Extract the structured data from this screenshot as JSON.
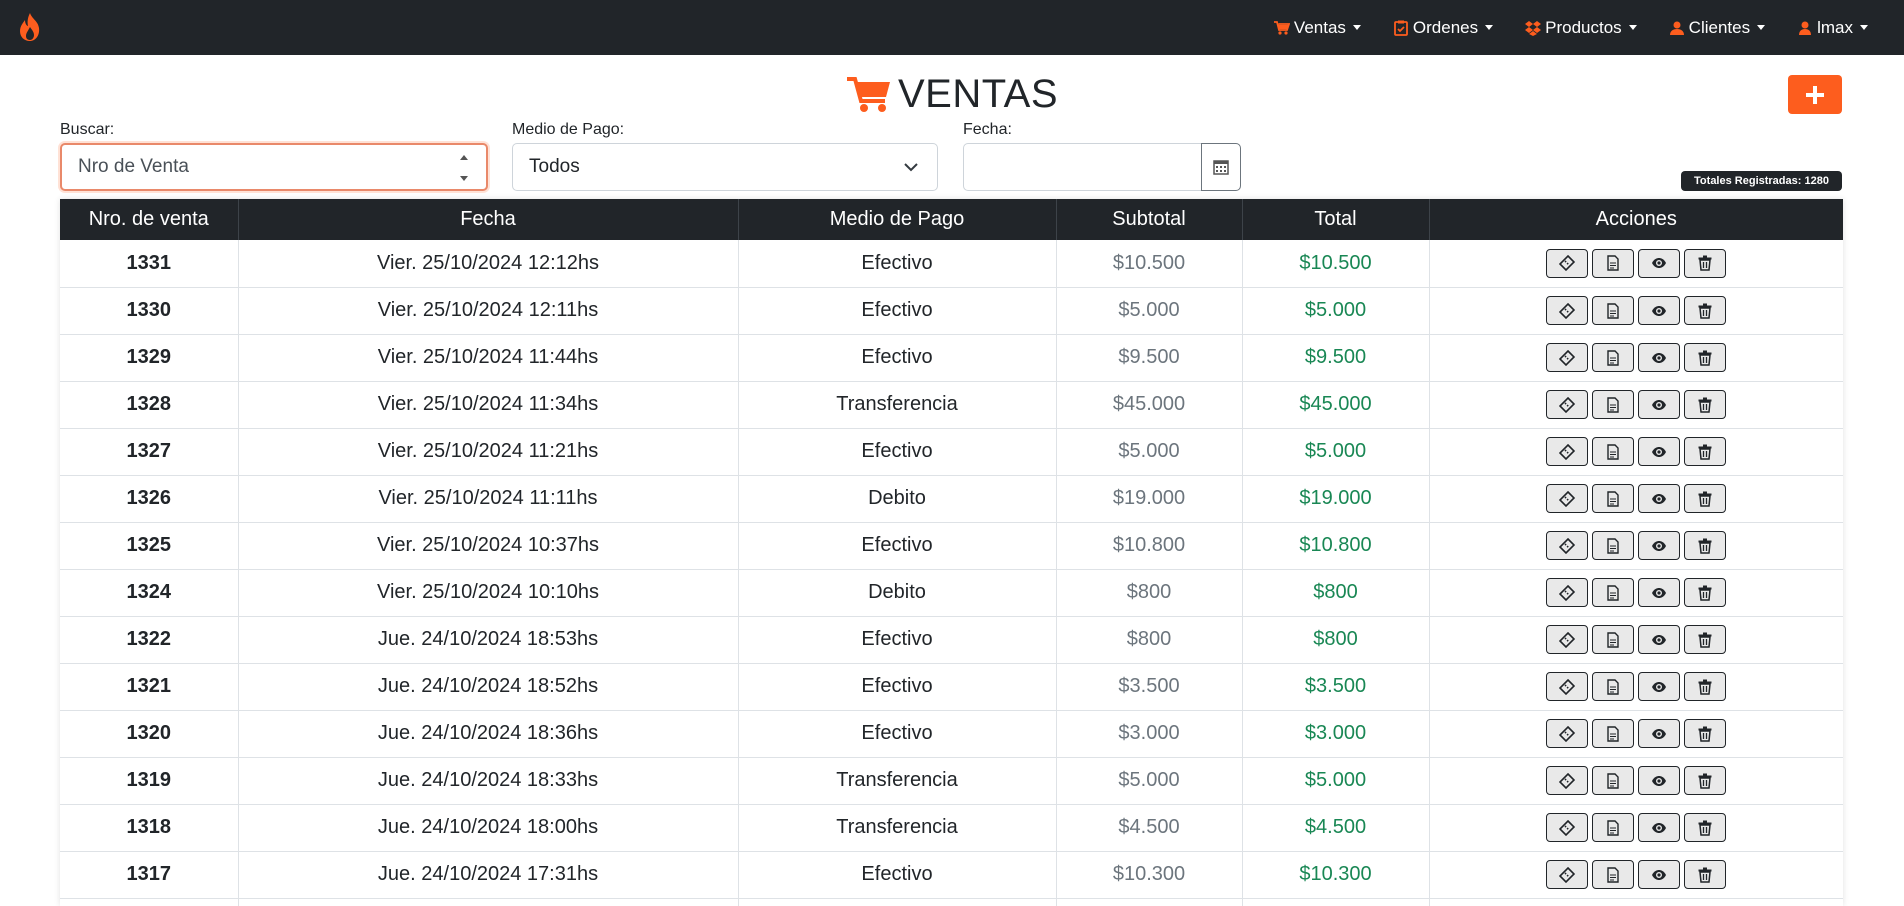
{
  "navbar": {
    "brand_icon": "fire-icon",
    "accent_color": "#fd5d1e",
    "menu": [
      {
        "label": "Ventas",
        "icon": "cart-icon"
      },
      {
        "label": "Ordenes",
        "icon": "clipboard-check-icon"
      },
      {
        "label": "Productos",
        "icon": "dropbox-icon"
      },
      {
        "label": "Clientes",
        "icon": "users-icon"
      },
      {
        "label": "lmax",
        "icon": "user-icon"
      }
    ]
  },
  "page": {
    "title": "VENTAS",
    "title_icon": "cart-icon",
    "add_button_icon": "plus-icon"
  },
  "filters": {
    "search_label": "Buscar:",
    "search_placeholder": "Nro de Venta",
    "payment_label": "Medio de Pago:",
    "payment_selected": "Todos",
    "date_label": "Fecha:",
    "date_value": "",
    "calendar_icon": "calendar-icon"
  },
  "totals_badge": "Totales Registradas: 1280",
  "table": {
    "headers": [
      "Nro. de venta",
      "Fecha",
      "Medio de Pago",
      "Subtotal",
      "Total",
      "Acciones"
    ],
    "action_icons": [
      "ticket-icon",
      "document-icon",
      "eye-icon",
      "trash-icon"
    ],
    "rows": [
      {
        "nro": "1331",
        "fecha": "Vier. 25/10/2024 12:12hs",
        "medio": "Efectivo",
        "subtotal": "$10.500",
        "total": "$10.500"
      },
      {
        "nro": "1330",
        "fecha": "Vier. 25/10/2024 12:11hs",
        "medio": "Efectivo",
        "subtotal": "$5.000",
        "total": "$5.000"
      },
      {
        "nro": "1329",
        "fecha": "Vier. 25/10/2024 11:44hs",
        "medio": "Efectivo",
        "subtotal": "$9.500",
        "total": "$9.500"
      },
      {
        "nro": "1328",
        "fecha": "Vier. 25/10/2024 11:34hs",
        "medio": "Transferencia",
        "subtotal": "$45.000",
        "total": "$45.000"
      },
      {
        "nro": "1327",
        "fecha": "Vier. 25/10/2024 11:21hs",
        "medio": "Efectivo",
        "subtotal": "$5.000",
        "total": "$5.000"
      },
      {
        "nro": "1326",
        "fecha": "Vier. 25/10/2024 11:11hs",
        "medio": "Debito",
        "subtotal": "$19.000",
        "total": "$19.000"
      },
      {
        "nro": "1325",
        "fecha": "Vier. 25/10/2024 10:37hs",
        "medio": "Efectivo",
        "subtotal": "$10.800",
        "total": "$10.800"
      },
      {
        "nro": "1324",
        "fecha": "Vier. 25/10/2024 10:10hs",
        "medio": "Debito",
        "subtotal": "$800",
        "total": "$800"
      },
      {
        "nro": "1322",
        "fecha": "Jue. 24/10/2024 18:53hs",
        "medio": "Efectivo",
        "subtotal": "$800",
        "total": "$800"
      },
      {
        "nro": "1321",
        "fecha": "Jue. 24/10/2024 18:52hs",
        "medio": "Efectivo",
        "subtotal": "$3.500",
        "total": "$3.500"
      },
      {
        "nro": "1320",
        "fecha": "Jue. 24/10/2024 18:36hs",
        "medio": "Efectivo",
        "subtotal": "$3.000",
        "total": "$3.000"
      },
      {
        "nro": "1319",
        "fecha": "Jue. 24/10/2024 18:33hs",
        "medio": "Transferencia",
        "subtotal": "$5.000",
        "total": "$5.000"
      },
      {
        "nro": "1318",
        "fecha": "Jue. 24/10/2024 18:00hs",
        "medio": "Transferencia",
        "subtotal": "$4.500",
        "total": "$4.500"
      },
      {
        "nro": "1317",
        "fecha": "Jue. 24/10/2024 17:31hs",
        "medio": "Efectivo",
        "subtotal": "$10.300",
        "total": "$10.300"
      },
      {
        "nro": "",
        "fecha": "",
        "medio": "",
        "subtotal": "",
        "total": ""
      }
    ]
  }
}
